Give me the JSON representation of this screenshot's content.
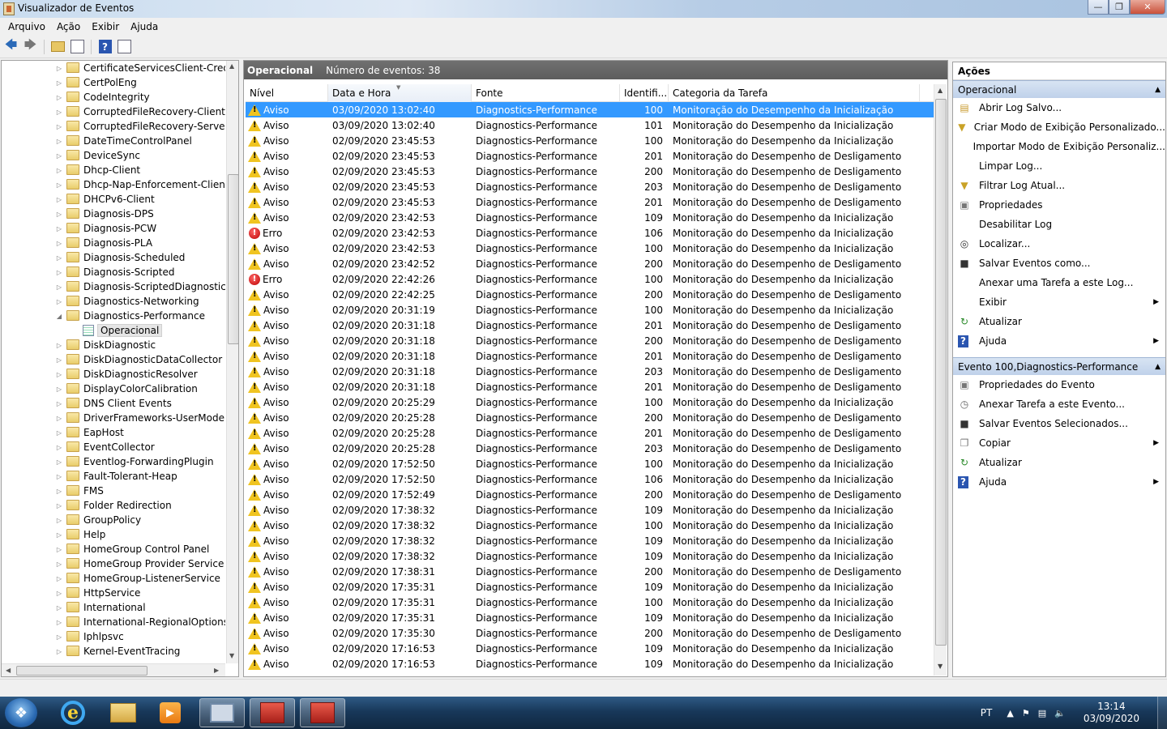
{
  "window": {
    "title": "Visualizador de Eventos"
  },
  "menu": [
    "Arquivo",
    "Ação",
    "Exibir",
    "Ajuda"
  ],
  "tree": {
    "items": [
      "CertificateServicesClient-Credent",
      "CertPolEng",
      "CodeIntegrity",
      "CorruptedFileRecovery-Client",
      "CorruptedFileRecovery-Server",
      "DateTimeControlPanel",
      "DeviceSync",
      "Dhcp-Client",
      "Dhcp-Nap-Enforcement-Client",
      "DHCPv6-Client",
      "Diagnosis-DPS",
      "Diagnosis-PCW",
      "Diagnosis-PLA",
      "Diagnosis-Scheduled",
      "Diagnosis-Scripted",
      "Diagnosis-ScriptedDiagnosticsPr",
      "Diagnostics-Networking",
      "Diagnostics-Performance",
      "Operacional",
      "DiskDiagnostic",
      "DiskDiagnosticDataCollector",
      "DiskDiagnosticResolver",
      "DisplayColorCalibration",
      "DNS Client Events",
      "DriverFrameworks-UserMode",
      "EapHost",
      "EventCollector",
      "Eventlog-ForwardingPlugin",
      "Fault-Tolerant-Heap",
      "FMS",
      "Folder Redirection",
      "GroupPolicy",
      "Help",
      "HomeGroup Control Panel",
      "HomeGroup Provider Service",
      "HomeGroup-ListenerService",
      "HttpService",
      "International",
      "International-RegionalOptionsCo",
      "Iphlpsvc",
      "Kernel-EventTracing"
    ]
  },
  "center": {
    "log_name": "Operacional",
    "count_label": "Número de eventos: 38",
    "columns": [
      "Nível",
      "Data e Hora",
      "Fonte",
      "Identifi...",
      "Categoria da Tarefa"
    ],
    "rows": [
      {
        "level": "Aviso",
        "datetime": "03/09/2020 13:02:40",
        "source": "Diagnostics-Performance",
        "id": "100",
        "category": "Monitoração do Desempenho da Inicialização"
      },
      {
        "level": "Aviso",
        "datetime": "03/09/2020 13:02:40",
        "source": "Diagnostics-Performance",
        "id": "101",
        "category": "Monitoração do Desempenho da Inicialização"
      },
      {
        "level": "Aviso",
        "datetime": "02/09/2020 23:45:53",
        "source": "Diagnostics-Performance",
        "id": "100",
        "category": "Monitoração do Desempenho da Inicialização"
      },
      {
        "level": "Aviso",
        "datetime": "02/09/2020 23:45:53",
        "source": "Diagnostics-Performance",
        "id": "201",
        "category": "Monitoração do Desempenho de Desligamento"
      },
      {
        "level": "Aviso",
        "datetime": "02/09/2020 23:45:53",
        "source": "Diagnostics-Performance",
        "id": "200",
        "category": "Monitoração do Desempenho de Desligamento"
      },
      {
        "level": "Aviso",
        "datetime": "02/09/2020 23:45:53",
        "source": "Diagnostics-Performance",
        "id": "203",
        "category": "Monitoração do Desempenho de Desligamento"
      },
      {
        "level": "Aviso",
        "datetime": "02/09/2020 23:45:53",
        "source": "Diagnostics-Performance",
        "id": "201",
        "category": "Monitoração do Desempenho de Desligamento"
      },
      {
        "level": "Aviso",
        "datetime": "02/09/2020 23:42:53",
        "source": "Diagnostics-Performance",
        "id": "109",
        "category": "Monitoração do Desempenho da Inicialização"
      },
      {
        "level": "Erro",
        "datetime": "02/09/2020 23:42:53",
        "source": "Diagnostics-Performance",
        "id": "106",
        "category": "Monitoração do Desempenho da Inicialização"
      },
      {
        "level": "Aviso",
        "datetime": "02/09/2020 23:42:53",
        "source": "Diagnostics-Performance",
        "id": "100",
        "category": "Monitoração do Desempenho da Inicialização"
      },
      {
        "level": "Aviso",
        "datetime": "02/09/2020 23:42:52",
        "source": "Diagnostics-Performance",
        "id": "200",
        "category": "Monitoração do Desempenho de Desligamento"
      },
      {
        "level": "Erro",
        "datetime": "02/09/2020 22:42:26",
        "source": "Diagnostics-Performance",
        "id": "100",
        "category": "Monitoração do Desempenho da Inicialização"
      },
      {
        "level": "Aviso",
        "datetime": "02/09/2020 22:42:25",
        "source": "Diagnostics-Performance",
        "id": "200",
        "category": "Monitoração do Desempenho de Desligamento"
      },
      {
        "level": "Aviso",
        "datetime": "02/09/2020 20:31:19",
        "source": "Diagnostics-Performance",
        "id": "100",
        "category": "Monitoração do Desempenho da Inicialização"
      },
      {
        "level": "Aviso",
        "datetime": "02/09/2020 20:31:18",
        "source": "Diagnostics-Performance",
        "id": "201",
        "category": "Monitoração do Desempenho de Desligamento"
      },
      {
        "level": "Aviso",
        "datetime": "02/09/2020 20:31:18",
        "source": "Diagnostics-Performance",
        "id": "200",
        "category": "Monitoração do Desempenho de Desligamento"
      },
      {
        "level": "Aviso",
        "datetime": "02/09/2020 20:31:18",
        "source": "Diagnostics-Performance",
        "id": "201",
        "category": "Monitoração do Desempenho de Desligamento"
      },
      {
        "level": "Aviso",
        "datetime": "02/09/2020 20:31:18",
        "source": "Diagnostics-Performance",
        "id": "203",
        "category": "Monitoração do Desempenho de Desligamento"
      },
      {
        "level": "Aviso",
        "datetime": "02/09/2020 20:31:18",
        "source": "Diagnostics-Performance",
        "id": "201",
        "category": "Monitoração do Desempenho de Desligamento"
      },
      {
        "level": "Aviso",
        "datetime": "02/09/2020 20:25:29",
        "source": "Diagnostics-Performance",
        "id": "100",
        "category": "Monitoração do Desempenho da Inicialização"
      },
      {
        "level": "Aviso",
        "datetime": "02/09/2020 20:25:28",
        "source": "Diagnostics-Performance",
        "id": "200",
        "category": "Monitoração do Desempenho de Desligamento"
      },
      {
        "level": "Aviso",
        "datetime": "02/09/2020 20:25:28",
        "source": "Diagnostics-Performance",
        "id": "201",
        "category": "Monitoração do Desempenho de Desligamento"
      },
      {
        "level": "Aviso",
        "datetime": "02/09/2020 20:25:28",
        "source": "Diagnostics-Performance",
        "id": "203",
        "category": "Monitoração do Desempenho de Desligamento"
      },
      {
        "level": "Aviso",
        "datetime": "02/09/2020 17:52:50",
        "source": "Diagnostics-Performance",
        "id": "100",
        "category": "Monitoração do Desempenho da Inicialização"
      },
      {
        "level": "Aviso",
        "datetime": "02/09/2020 17:52:50",
        "source": "Diagnostics-Performance",
        "id": "106",
        "category": "Monitoração do Desempenho da Inicialização"
      },
      {
        "level": "Aviso",
        "datetime": "02/09/2020 17:52:49",
        "source": "Diagnostics-Performance",
        "id": "200",
        "category": "Monitoração do Desempenho de Desligamento"
      },
      {
        "level": "Aviso",
        "datetime": "02/09/2020 17:38:32",
        "source": "Diagnostics-Performance",
        "id": "109",
        "category": "Monitoração do Desempenho da Inicialização"
      },
      {
        "level": "Aviso",
        "datetime": "02/09/2020 17:38:32",
        "source": "Diagnostics-Performance",
        "id": "100",
        "category": "Monitoração do Desempenho da Inicialização"
      },
      {
        "level": "Aviso",
        "datetime": "02/09/2020 17:38:32",
        "source": "Diagnostics-Performance",
        "id": "109",
        "category": "Monitoração do Desempenho da Inicialização"
      },
      {
        "level": "Aviso",
        "datetime": "02/09/2020 17:38:32",
        "source": "Diagnostics-Performance",
        "id": "109",
        "category": "Monitoração do Desempenho da Inicialização"
      },
      {
        "level": "Aviso",
        "datetime": "02/09/2020 17:38:31",
        "source": "Diagnostics-Performance",
        "id": "200",
        "category": "Monitoração do Desempenho de Desligamento"
      },
      {
        "level": "Aviso",
        "datetime": "02/09/2020 17:35:31",
        "source": "Diagnostics-Performance",
        "id": "109",
        "category": "Monitoração do Desempenho da Inicialização"
      },
      {
        "level": "Aviso",
        "datetime": "02/09/2020 17:35:31",
        "source": "Diagnostics-Performance",
        "id": "100",
        "category": "Monitoração do Desempenho da Inicialização"
      },
      {
        "level": "Aviso",
        "datetime": "02/09/2020 17:35:31",
        "source": "Diagnostics-Performance",
        "id": "109",
        "category": "Monitoração do Desempenho da Inicialização"
      },
      {
        "level": "Aviso",
        "datetime": "02/09/2020 17:35:30",
        "source": "Diagnostics-Performance",
        "id": "200",
        "category": "Monitoração do Desempenho de Desligamento"
      },
      {
        "level": "Aviso",
        "datetime": "02/09/2020 17:16:53",
        "source": "Diagnostics-Performance",
        "id": "109",
        "category": "Monitoração do Desempenho da Inicialização"
      },
      {
        "level": "Aviso",
        "datetime": "02/09/2020 17:16:53",
        "source": "Diagnostics-Performance",
        "id": "109",
        "category": "Monitoração do Desempenho da Inicialização"
      }
    ]
  },
  "actions": {
    "title": "Ações",
    "section1": {
      "title": "Operacional",
      "items": [
        {
          "label": "Abrir Log Salvo...",
          "icon": "open-folder-icon"
        },
        {
          "label": "Criar Modo de Exibição Personalizado...",
          "icon": "filter-icon"
        },
        {
          "label": "Importar Modo de Exibição Personaliz...",
          "icon": ""
        },
        {
          "label": "Limpar Log...",
          "icon": ""
        },
        {
          "label": "Filtrar Log Atual...",
          "icon": "filter-icon"
        },
        {
          "label": "Propriedades",
          "icon": "properties-icon"
        },
        {
          "label": "Desabilitar Log",
          "icon": ""
        },
        {
          "label": "Localizar...",
          "icon": "binoculars-icon"
        },
        {
          "label": "Salvar Eventos como...",
          "icon": "save-icon"
        },
        {
          "label": "Anexar uma Tarefa a este Log...",
          "icon": ""
        },
        {
          "label": "Exibir",
          "icon": "",
          "submenu": true
        },
        {
          "label": "Atualizar",
          "icon": "refresh-icon"
        },
        {
          "label": "Ajuda",
          "icon": "help-icon",
          "submenu": true
        }
      ]
    },
    "section2": {
      "title": "Evento 100,Diagnostics-Performance",
      "items": [
        {
          "label": "Propriedades do Evento",
          "icon": "properties-icon"
        },
        {
          "label": "Anexar Tarefa a este Evento...",
          "icon": "task-icon"
        },
        {
          "label": "Salvar Eventos Selecionados...",
          "icon": "save-icon"
        },
        {
          "label": "Copiar",
          "icon": "copy-icon",
          "submenu": true
        },
        {
          "label": "Atualizar",
          "icon": "refresh-icon"
        },
        {
          "label": "Ajuda",
          "icon": "help-icon",
          "submenu": true
        }
      ]
    }
  },
  "taskbar": {
    "lang": "PT",
    "time": "13:14",
    "date": "03/09/2020"
  },
  "colors": {
    "selection": "#3399ff",
    "warning": "#f0c420",
    "error": "#cc0000",
    "header_bar": "#646464"
  }
}
